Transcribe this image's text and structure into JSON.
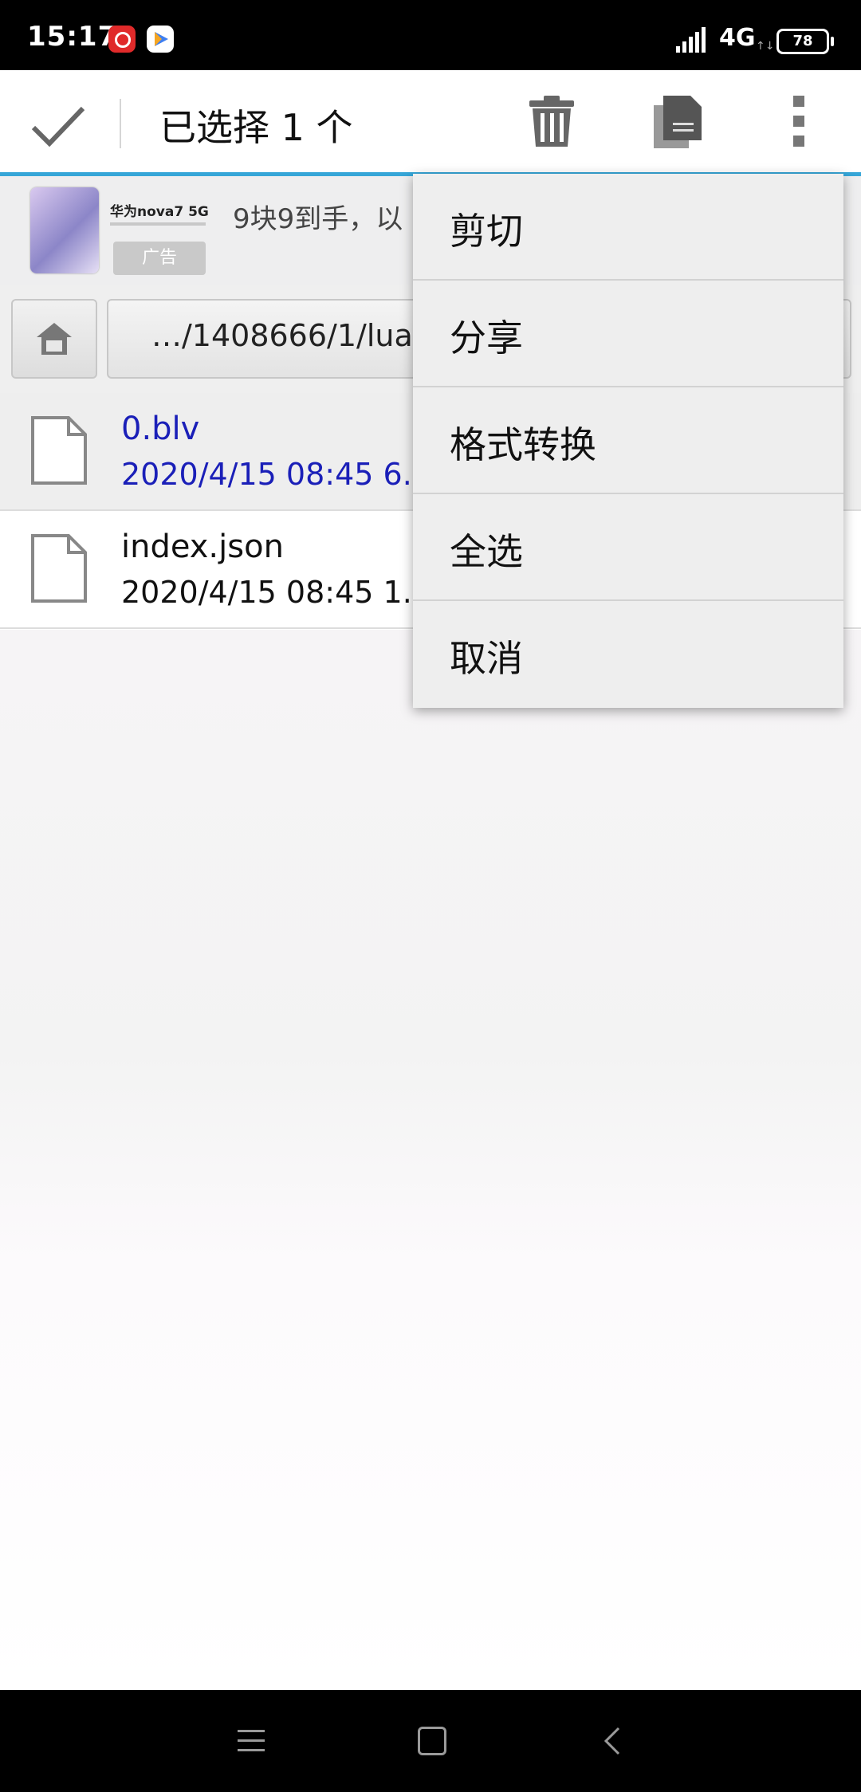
{
  "status_bar": {
    "time": "15:17",
    "network": "4G",
    "battery": "78",
    "icons": [
      "netease-music-icon",
      "video-app-icon",
      "signal-icon",
      "battery-icon"
    ]
  },
  "toolbar": {
    "title": "已选择 1 个",
    "icons": [
      "checkmark-icon",
      "trash-icon",
      "copy-icon",
      "more-vert-icon"
    ],
    "accent_color": "#36a6d8"
  },
  "ad": {
    "brand": "华为nova7 5G",
    "tag": "广告",
    "text": "9块9到手，以"
  },
  "path": {
    "text": "…/1408666/1/lua"
  },
  "files": [
    {
      "name": "0.blv",
      "meta": "2020/4/15 08:45   6.",
      "selected": true
    },
    {
      "name": "index.json",
      "meta": "2020/4/15 08:45   1.",
      "selected": false
    }
  ],
  "menu": {
    "items": [
      {
        "label": "剪切"
      },
      {
        "label": "分享"
      },
      {
        "label": "格式转换"
      },
      {
        "label": "全选"
      },
      {
        "label": "取消"
      }
    ]
  },
  "nav": {
    "icons": [
      "menu-icon",
      "home-icon",
      "back-icon"
    ]
  },
  "colors": {
    "selected_text": "#1a1fb8",
    "menu_bg": "#eeeeee"
  }
}
